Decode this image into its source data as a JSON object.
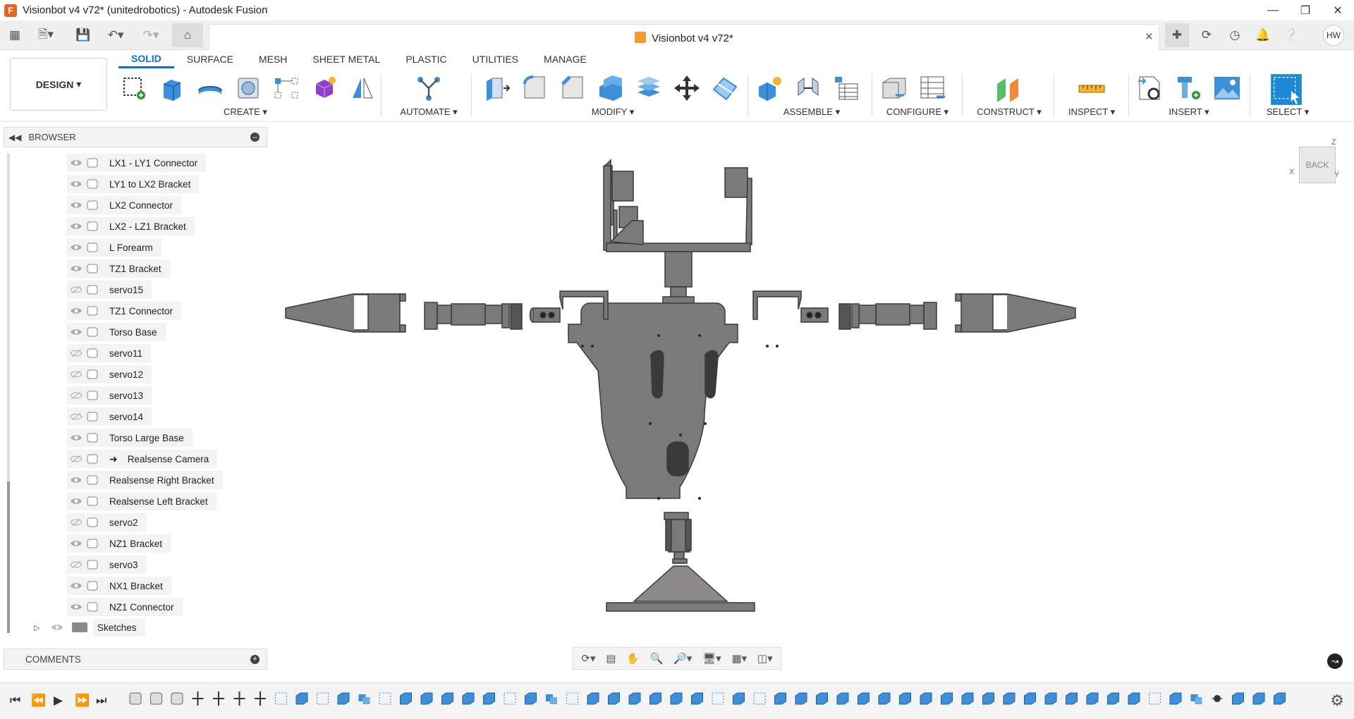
{
  "window": {
    "title": "Visionbot v4 v72* (unitedrobotics) - Autodesk Fusion",
    "logo_letter": "F",
    "controls": [
      "minimize",
      "restore",
      "close"
    ]
  },
  "doc_tab": {
    "title": "Visionbot v4 v72*",
    "close": "×"
  },
  "user": {
    "initials": "HW"
  },
  "workspace": {
    "label": "DESIGN"
  },
  "tabs": [
    "SOLID",
    "SURFACE",
    "MESH",
    "SHEET METAL",
    "PLASTIC",
    "UTILITIES",
    "MANAGE"
  ],
  "active_tab": "SOLID",
  "tool_groups": {
    "create": "CREATE",
    "automate": "AUTOMATE",
    "modify": "MODIFY",
    "assemble": "ASSEMBLE",
    "configure": "CONFIGURE",
    "construct": "CONSTRUCT",
    "inspect": "INSPECT",
    "insert": "INSERT",
    "select": "SELECT"
  },
  "browser": {
    "title": "BROWSER",
    "items": [
      {
        "label": "LX1 - LY1 Connector",
        "visible": true
      },
      {
        "label": "LY1 to LX2 Bracket",
        "visible": true
      },
      {
        "label": "LX2 Connector",
        "visible": true
      },
      {
        "label": "LX2 - LZ1 Bracket",
        "visible": true
      },
      {
        "label": "L Forearm",
        "visible": true
      },
      {
        "label": "TZ1 Bracket",
        "visible": true
      },
      {
        "label": "servo15",
        "visible": false
      },
      {
        "label": "TZ1 Connector",
        "visible": true
      },
      {
        "label": "Torso Base",
        "visible": true
      },
      {
        "label": "servo11",
        "visible": false
      },
      {
        "label": "servo12",
        "visible": false
      },
      {
        "label": "servo13",
        "visible": false
      },
      {
        "label": "servo14",
        "visible": false
      },
      {
        "label": "Torso Large Base",
        "visible": true
      },
      {
        "label": "Realsense Camera",
        "visible": false
      },
      {
        "label": "Realsense Right Bracket",
        "visible": true
      },
      {
        "label": "Realsense Left Bracket",
        "visible": true
      },
      {
        "label": "servo2",
        "visible": false
      },
      {
        "label": "NZ1 Bracket",
        "visible": true
      },
      {
        "label": "servo3",
        "visible": false
      },
      {
        "label": "NX1 Bracket",
        "visible": true
      },
      {
        "label": "NZ1 Connector",
        "visible": true
      }
    ],
    "sketches": "Sketches"
  },
  "comments": {
    "title": "COMMENTS"
  },
  "viewcube": {
    "face": "BACK",
    "axis_x": "X",
    "axis_y": "Y",
    "axis_z": "Z"
  },
  "colors": {
    "accent": "#0b6fd1",
    "model_fill": "#7a7a78",
    "model_stroke": "#3a3a3a",
    "toolbar_blue": "#3d8fd9"
  }
}
